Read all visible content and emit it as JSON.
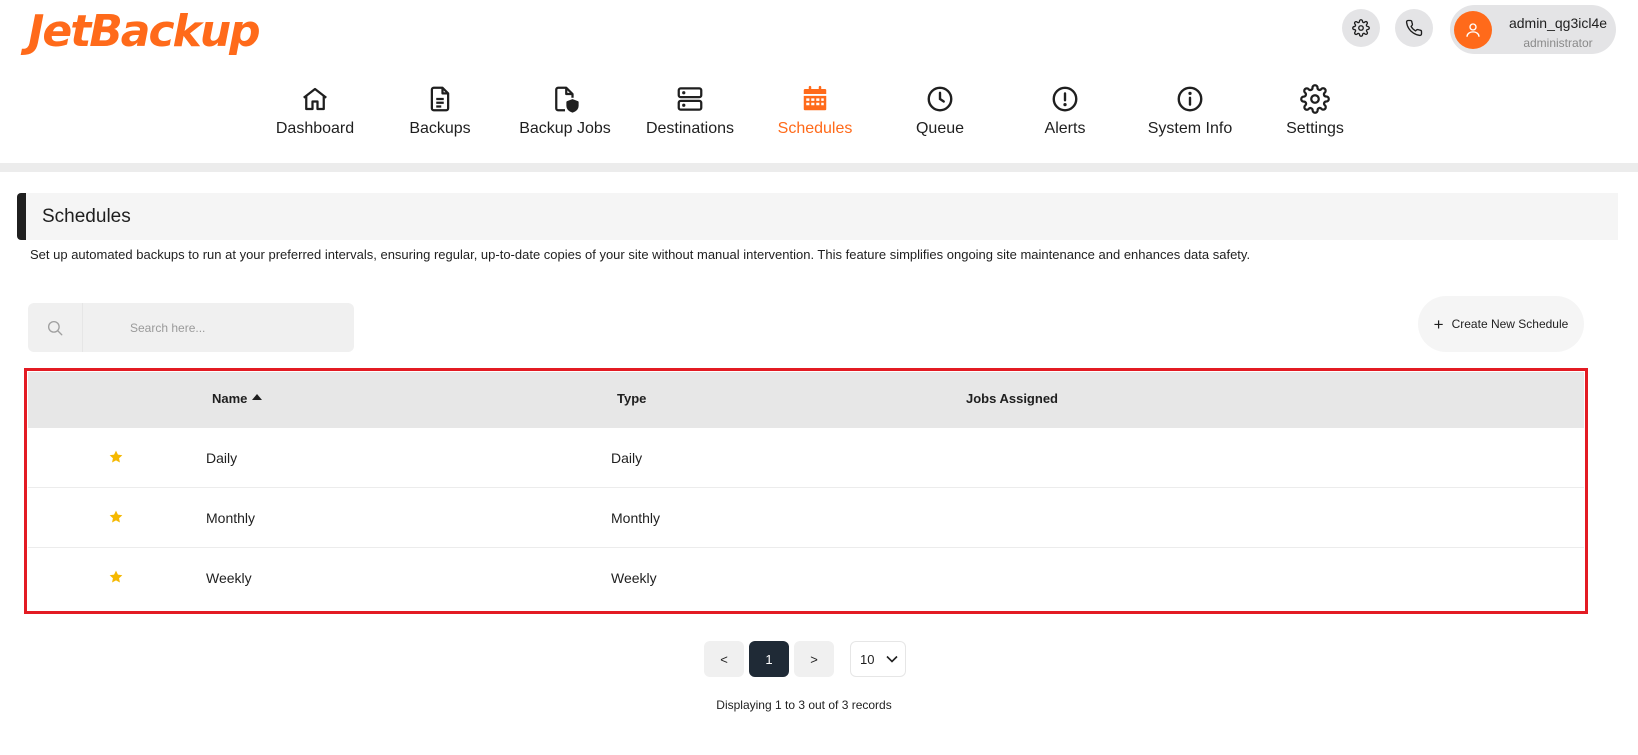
{
  "app": {
    "logo_text": "JetBackup",
    "brand_color": "#ff6a1a"
  },
  "header": {
    "settings_icon": "gear-icon",
    "support_icon": "phone-icon",
    "user": {
      "name": "admin_qg3icl4e",
      "role": "administrator"
    }
  },
  "nav": {
    "items": [
      {
        "label": "Dashboard",
        "icon": "home-icon"
      },
      {
        "label": "Backups",
        "icon": "document-icon"
      },
      {
        "label": "Backup Jobs",
        "icon": "file-shield-icon"
      },
      {
        "label": "Destinations",
        "icon": "server-icon"
      },
      {
        "label": "Schedules",
        "icon": "calendar-icon",
        "active": true
      },
      {
        "label": "Queue",
        "icon": "clock-icon"
      },
      {
        "label": "Alerts",
        "icon": "alert-circle-icon"
      },
      {
        "label": "System Info",
        "icon": "info-circle-icon"
      },
      {
        "label": "Settings",
        "icon": "gear-icon"
      }
    ]
  },
  "page": {
    "title": "Schedules",
    "description": "Set up automated backups to run at your preferred intervals, ensuring regular, up-to-date copies of your site without manual intervention. This feature simplifies ongoing site maintenance and enhances data safety."
  },
  "search": {
    "placeholder": "Search here..."
  },
  "toolbar": {
    "create_label": "Create New Schedule"
  },
  "table": {
    "columns": {
      "name": "Name",
      "type": "Type",
      "jobs": "Jobs Assigned"
    },
    "sort_column": "Name",
    "sort_direction": "ascending",
    "rows": [
      {
        "name": "Daily",
        "type": "Daily",
        "jobs": "",
        "starred": true
      },
      {
        "name": "Monthly",
        "type": "Monthly",
        "jobs": "",
        "starred": true
      },
      {
        "name": "Weekly",
        "type": "Weekly",
        "jobs": "",
        "starred": true
      }
    ]
  },
  "pagination": {
    "prev_label": "<",
    "current_page": "1",
    "next_label": ">",
    "per_page": "10",
    "summary": "Displaying 1 to 3 out of 3 records"
  }
}
